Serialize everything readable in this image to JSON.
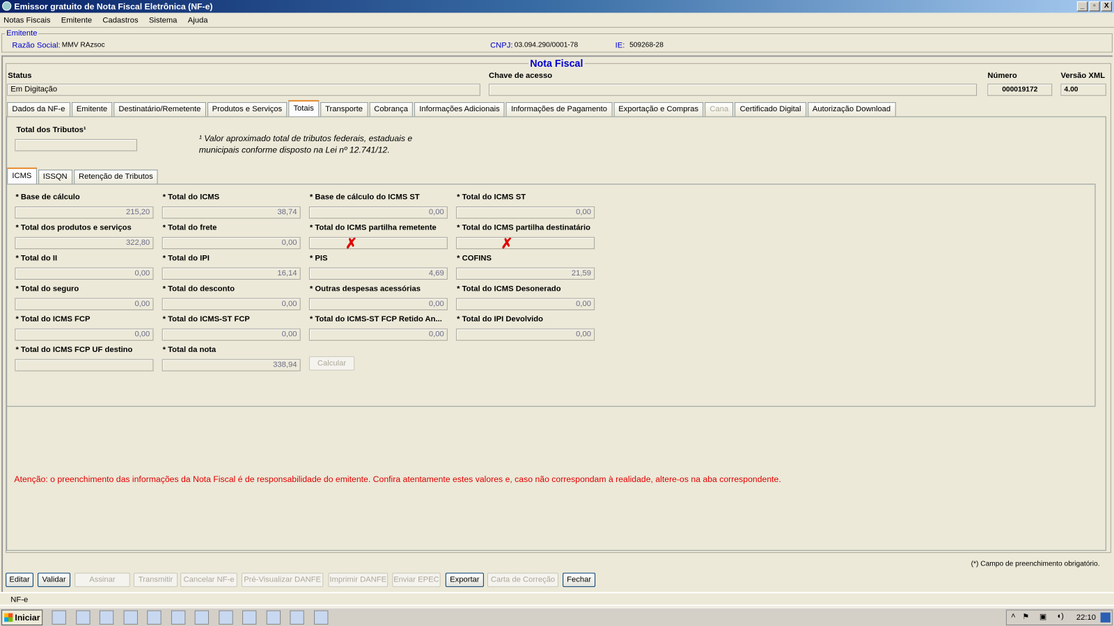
{
  "window": {
    "title": "Emissor gratuito de Nota Fiscal Eletrônica (NF-e)",
    "minimize": "_",
    "restore": "▫",
    "close": "X"
  },
  "menu": [
    "Notas Fiscais",
    "Emitente",
    "Cadastros",
    "Sistema",
    "Ajuda"
  ],
  "emitente": {
    "group_title": "Emitente",
    "razao_label": "Razão Social:",
    "razao_value": "MMV RAzsoc",
    "cnpj_label": "CNPJ:",
    "cnpj_value": "03.094.290/0001-78",
    "ie_label": "IE:",
    "ie_value": "509268-28"
  },
  "nota": {
    "group_title": "Nota Fiscal",
    "status_label": "Status",
    "status_value": "Em Digitação",
    "chave_label": "Chave de acesso",
    "chave_value": "",
    "numero_label": "Número",
    "numero_value": "000019172",
    "versao_label": "Versão XML",
    "versao_value": "4.00"
  },
  "tabs": [
    {
      "label": "Dados da NF-e"
    },
    {
      "label": "Emitente"
    },
    {
      "label": "Destinatário/Remetente"
    },
    {
      "label": "Produtos e Serviços"
    },
    {
      "label": "Totais",
      "selected": true
    },
    {
      "label": "Transporte"
    },
    {
      "label": "Cobrança"
    },
    {
      "label": "Informações Adicionais"
    },
    {
      "label": "Informações de Pagamento"
    },
    {
      "label": "Exportação e Compras"
    },
    {
      "label": "Cana",
      "disabled": true
    },
    {
      "label": "Certificado Digital"
    },
    {
      "label": "Autorização Download"
    }
  ],
  "totais": {
    "tributos_label": "Total dos Tributos¹",
    "tributos_value": "",
    "note_line1": "¹ Valor aproximado total de tributos federais, estaduais e",
    "note_line2": "municipais conforme disposto na Lei nº 12.741/12.",
    "subtabs": [
      {
        "label": "ICMS",
        "selected": true
      },
      {
        "label": "ISSQN"
      },
      {
        "label": "Retenção de Tributos"
      }
    ],
    "fields": [
      {
        "label": "* Base de cálculo",
        "value": "215,20"
      },
      {
        "label": "* Total do ICMS",
        "value": "38,74"
      },
      {
        "label": "* Base de cálculo do ICMS ST",
        "value": "0,00"
      },
      {
        "label": "* Total do ICMS ST",
        "value": "0,00"
      },
      {
        "label": "* Total dos produtos e serviços",
        "value": "322,80"
      },
      {
        "label": "* Total do frete",
        "value": "0,00"
      },
      {
        "label": "* Total do ICMS partilha remetente",
        "value": "",
        "marked": true
      },
      {
        "label": "* Total do ICMS partilha destinatário",
        "value": "",
        "marked": true
      },
      {
        "label": "* Total do II",
        "value": "0,00"
      },
      {
        "label": "* Total do IPI",
        "value": "16,14"
      },
      {
        "label": "* PIS",
        "value": "4,69"
      },
      {
        "label": "* COFINS",
        "value": "21,59"
      },
      {
        "label": "* Total do seguro",
        "value": "0,00"
      },
      {
        "label": "* Total do desconto",
        "value": "0,00"
      },
      {
        "label": "* Outras despesas acessórias",
        "value": "0,00"
      },
      {
        "label": "* Total do ICMS Desonerado",
        "value": "0,00"
      },
      {
        "label": "* Total do ICMS FCP",
        "value": "0,00"
      },
      {
        "label": "* Total do ICMS-ST FCP",
        "value": "0,00"
      },
      {
        "label": "* Total do ICMS-ST FCP Retido An...",
        "value": "0,00"
      },
      {
        "label": "* Total do IPI Devolvido",
        "value": "0,00"
      },
      {
        "label": "* Total do ICMS FCP UF destino",
        "value": ""
      },
      {
        "label": "* Total da nota",
        "value": "338,94"
      }
    ],
    "calc_button": "Calcular",
    "mark_symbol": "✗"
  },
  "warning": "Atenção: o preenchimento das informações da Nota Fiscal é de responsabilidade do emitente. Confira atentamente estes valores e, caso não correspondam à realidade, altere-os na aba correspondente.",
  "required_note": "(*) Campo de preenchimento obrigatório.",
  "buttons": [
    {
      "label": "Editar",
      "enabled": true
    },
    {
      "label": "Validar",
      "enabled": true
    },
    {
      "label": "Assinar",
      "enabled": false
    },
    {
      "label": "Transmitir",
      "enabled": false
    },
    {
      "label": "Cancelar NF-e",
      "enabled": false
    },
    {
      "label": "Pré-Visualizar DANFE",
      "enabled": false
    },
    {
      "label": "Imprimir DANFE",
      "enabled": false
    },
    {
      "label": "Enviar EPEC",
      "enabled": false
    },
    {
      "label": "Exportar",
      "enabled": true
    },
    {
      "label": "Carta de Correção",
      "enabled": false
    },
    {
      "label": "Fechar",
      "enabled": true
    }
  ],
  "statusbar": "NF-e",
  "taskbar": {
    "start": "Iniciar",
    "clock": "22:10",
    "apps": [
      "chrome",
      "explorer",
      "word",
      "notepad",
      "paint",
      "cmd",
      "app",
      "app",
      "app",
      "app",
      "app",
      "nfe"
    ]
  },
  "colors": {
    "accent": "#0000cc",
    "warning": "#e00000"
  }
}
